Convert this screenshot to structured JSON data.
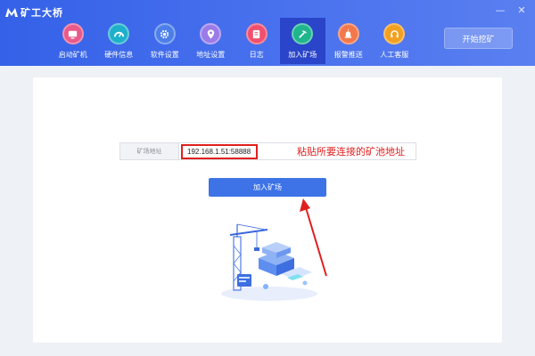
{
  "app": {
    "title": "矿工大桥"
  },
  "window_controls": {
    "minimize": "—",
    "close": "✕"
  },
  "nav": {
    "items": [
      {
        "label": "启动矿机",
        "icon": "monitor-icon",
        "color": "#e95a8a",
        "active": false
      },
      {
        "label": "硬件信息",
        "icon": "gauge-icon",
        "color": "#1fb0c9",
        "active": false
      },
      {
        "label": "软件设置",
        "icon": "gear-icon",
        "color": "#4c7fe8",
        "active": false
      },
      {
        "label": "地址设置",
        "icon": "location-icon",
        "color": "#9a7be8",
        "active": false
      },
      {
        "label": "日志",
        "icon": "document-icon",
        "color": "#f0506e",
        "active": false
      },
      {
        "label": "加入矿场",
        "icon": "mining-icon",
        "color": "#1fb58d",
        "active": true
      },
      {
        "label": "报警推送",
        "icon": "alarm-icon",
        "color": "#f2784b",
        "active": false
      },
      {
        "label": "人工客服",
        "icon": "headset-icon",
        "color": "#f2a020",
        "active": false
      }
    ]
  },
  "header": {
    "start_button": "开始挖矿"
  },
  "pool_form": {
    "label": "矿场地址",
    "value": "192.168.1.51:58888"
  },
  "annotation": {
    "text": "粘贴所要连接的矿池地址",
    "color": "#e02020"
  },
  "join_button": {
    "label": "加入矿场"
  },
  "colors": {
    "header_start": "#3461e8",
    "header_end": "#5a7ff0",
    "active_nav": "#2a45c9",
    "primary_button": "#3d73e6"
  }
}
